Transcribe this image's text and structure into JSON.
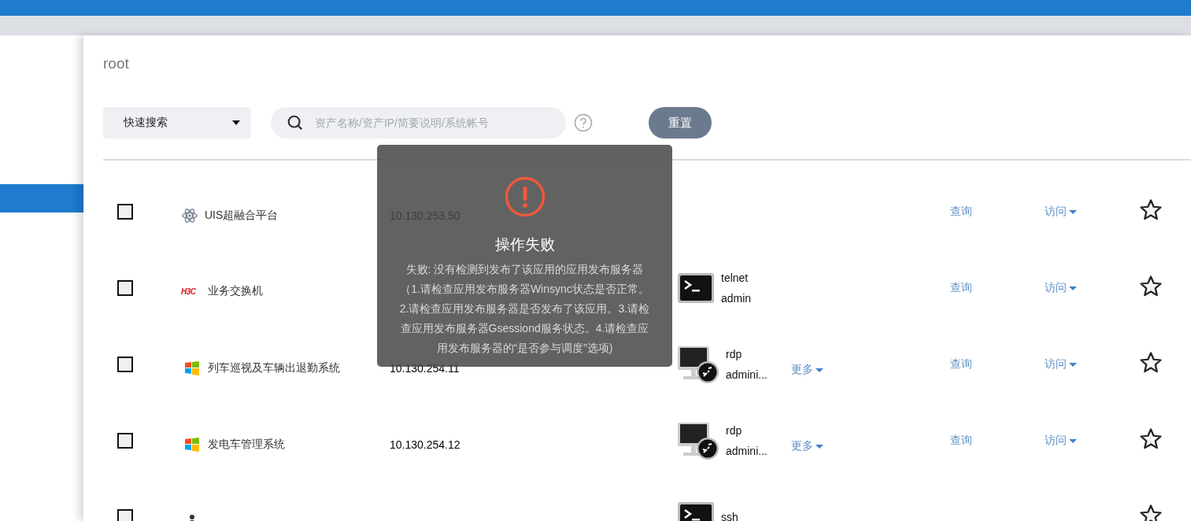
{
  "sidebar": {
    "items": [
      {
        "selected": true
      }
    ]
  },
  "header": {
    "user": "root"
  },
  "toolbar": {
    "search_type": "快速搜索",
    "search": {
      "placeholder": "资产名称/资产IP/简要说明/系统帐号"
    },
    "reset_button": "重置"
  },
  "rows": [
    {
      "checked": false,
      "icon": {
        "kind": "atom"
      },
      "name": "UIS超融合平台",
      "ip": "10.130.253.50",
      "query": "查询",
      "visit": "访问",
      "starred": false
    },
    {
      "checked": false,
      "icon": {
        "kind": "logo",
        "text": "H3C"
      },
      "name": "业务交换机",
      "protocol_icon": {
        "kind": "terminal"
      },
      "protocol": "telnet",
      "account": "admin",
      "query": "查询",
      "visit": "访问",
      "starred": false
    },
    {
      "checked": false,
      "icon": {
        "kind": "windows"
      },
      "name": "列车巡视及车辆出退勤系统",
      "ip": "10.130.254.11",
      "protocol_icon": {
        "kind": "remote"
      },
      "protocol": "rdp",
      "account": "admini...",
      "more": "更多",
      "query": "查询",
      "visit": "访问",
      "starred": false
    },
    {
      "checked": false,
      "icon": {
        "kind": "windows"
      },
      "name": "发电车管理系统",
      "ip": "10.130.254.12",
      "protocol_icon": {
        "kind": "remote"
      },
      "protocol": "rdp",
      "account": "admini...",
      "more": "更多",
      "query": "查询",
      "visit": "访问",
      "starred": false
    },
    {
      "checked": false,
      "icon": {
        "kind": "person"
      },
      "protocol_icon": {
        "kind": "terminal"
      },
      "protocol": "ssh",
      "starred": false
    }
  ],
  "toast": {
    "title": "操作失败",
    "message": "失败: 没有检测到发布了该应用的应用发布服务器（1.请检查应用发布服务器Winsync状态是否正常。2.请检查应用发布服务器是否发布了该应用。3.请检查应用发布服务器Gsessiond服务状态。4.请检查应用发布服务器的“是否参与调度”选项)"
  }
}
